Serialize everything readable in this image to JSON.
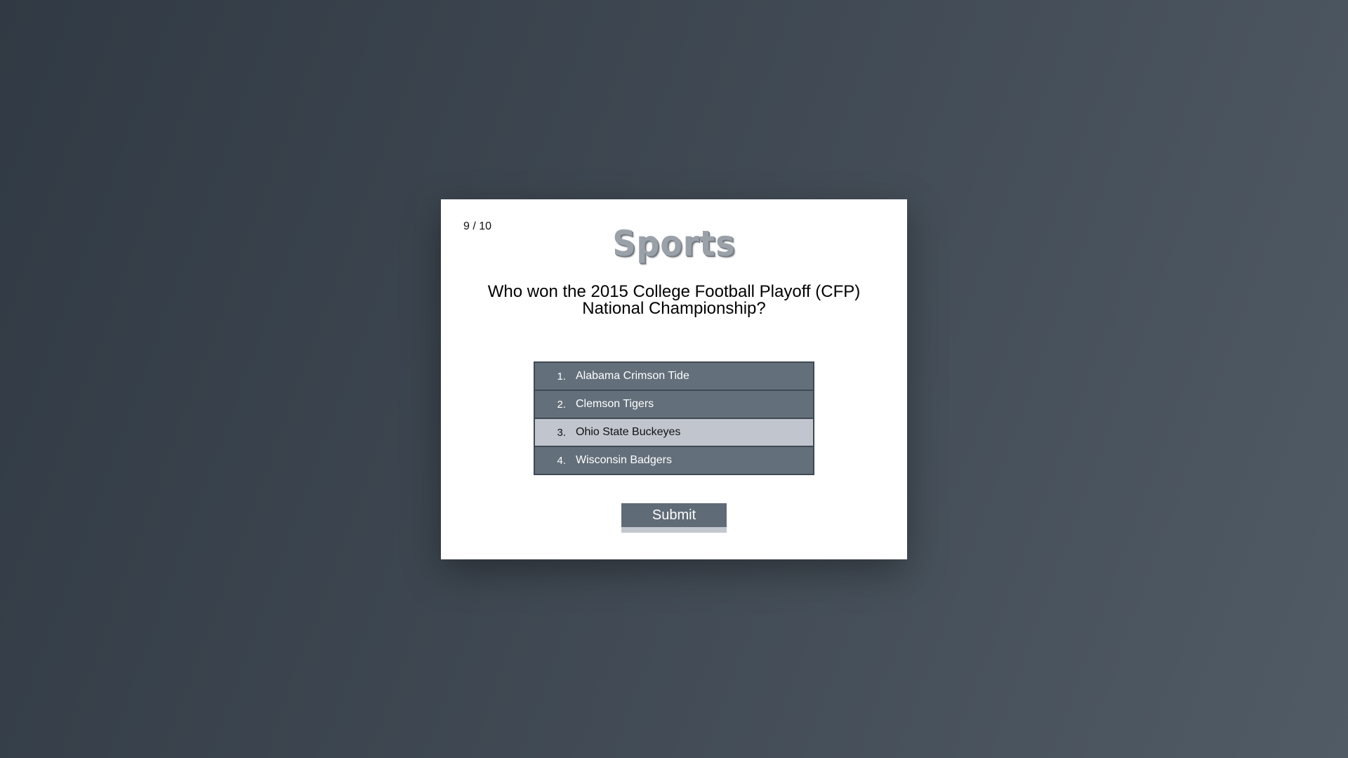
{
  "quiz": {
    "counter": "9 / 10",
    "category": "Sports",
    "question": "Who won the 2015 College Football Playoff (CFP) National Championship?",
    "answers": [
      {
        "number": "1.",
        "label": "Alabama Crimson Tide",
        "selected": false
      },
      {
        "number": "2.",
        "label": "Clemson Tigers",
        "selected": false
      },
      {
        "number": "3.",
        "label": "Ohio State Buckeyes",
        "selected": true
      },
      {
        "number": "4.",
        "label": "Wisconsin Badgers",
        "selected": false
      }
    ],
    "submit_label": "Submit"
  },
  "colors": {
    "background_dark": "#313a44",
    "background_light": "#515b65",
    "answer_bg": "#636f7a",
    "answer_selected_bg": "#c1c6ce",
    "submit_bg": "#5f6b76"
  }
}
